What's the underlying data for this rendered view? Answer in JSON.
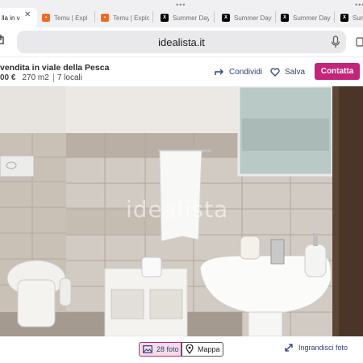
{
  "browser": {
    "tabs": [
      {
        "label": "lla in v",
        "favicon": "idealista-icon",
        "active": true
      },
      {
        "label": "Temu | Explo",
        "favicon": "temu-icon"
      },
      {
        "label": "Temu | Explo",
        "favicon": "temu-icon"
      },
      {
        "label": "Summer Day",
        "favicon": "x-icon"
      },
      {
        "label": "Summer Day",
        "favicon": "x-icon"
      },
      {
        "label": "Summer Day",
        "favicon": "x-icon"
      },
      {
        "label": "Summer Day",
        "favicon": "x-icon"
      }
    ],
    "close_glyph": "✕",
    "more_glyph": "•••",
    "url": "idealista.it"
  },
  "listing": {
    "title": "vendita in viale della Pesca",
    "price": "00 €",
    "area": "270 m2",
    "rooms": "7 locali"
  },
  "actions": {
    "share_label": "Condividi",
    "save_label": "Salva",
    "contact_label": "Contatta"
  },
  "photo": {
    "watermark": "idealista"
  },
  "gallery": {
    "photos_label": "28 foto",
    "map_label": "Mappa",
    "enlarge_label": "Ingrandisci foto"
  },
  "colors": {
    "brand": "#c4247a",
    "link": "#2b3f7a"
  }
}
